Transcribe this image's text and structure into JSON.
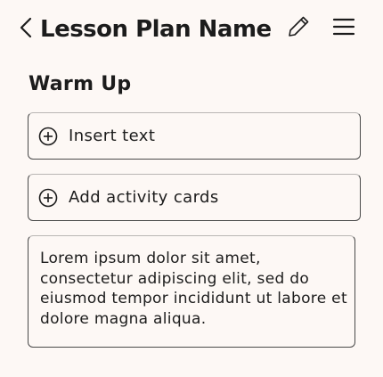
{
  "header": {
    "back_icon": "chevron-left-icon",
    "title": "Lesson Plan Name",
    "edit_icon": "pencil-icon",
    "menu_icon": "hamburger-menu-icon"
  },
  "section": {
    "title": "Warm Up"
  },
  "actions": [
    {
      "icon": "plus-circle-icon",
      "label": "Insert text"
    },
    {
      "icon": "plus-circle-icon",
      "label": "Add activity cards"
    }
  ],
  "text_block": {
    "content": "Lorem ipsum dolor sit amet, consectetur adipiscing elit, sed do eiusmod tempor incididunt ut labore et dolore magna aliqua."
  },
  "colors": {
    "background": "#fdf8f5",
    "text": "#1c1c1c",
    "border": "#4a4a4a"
  }
}
